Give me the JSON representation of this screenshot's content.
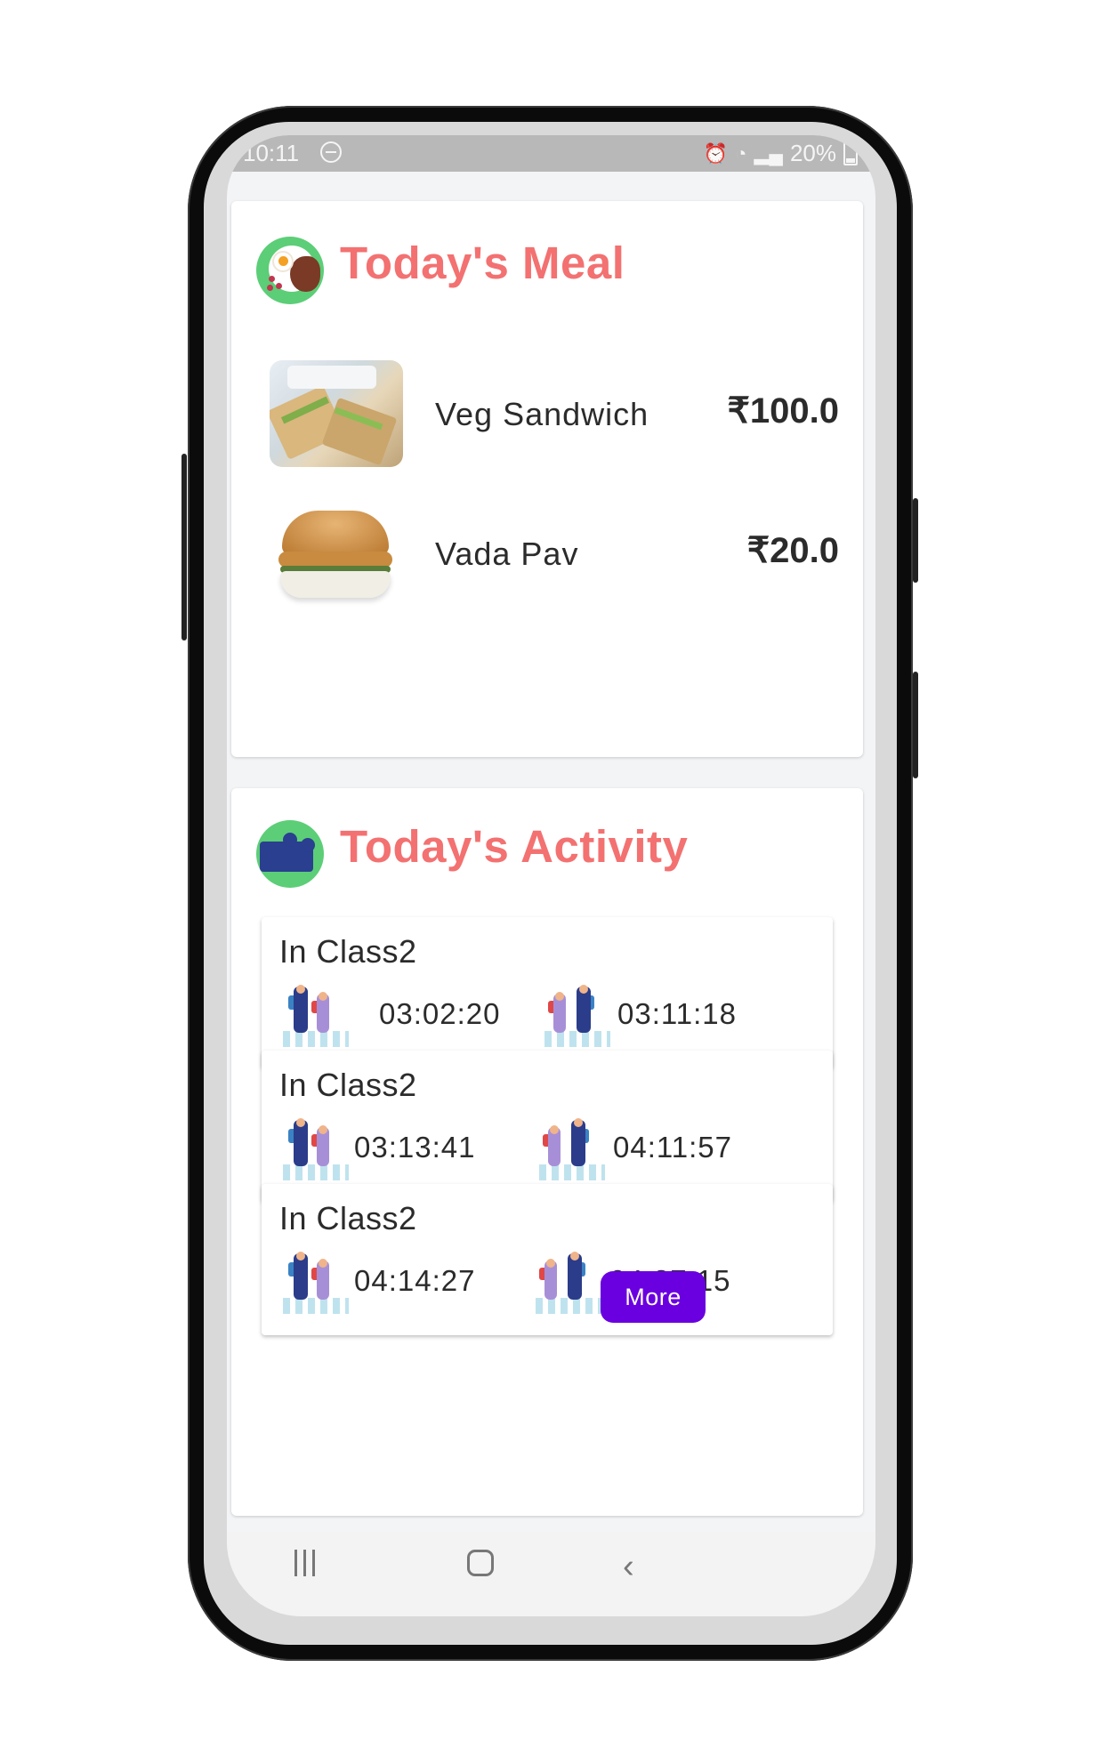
{
  "status_bar": {
    "time": "10:11",
    "battery": "20%"
  },
  "meal": {
    "title": "Today's Meal",
    "items": [
      {
        "name": "Veg Sandwich",
        "price": "₹100.0"
      },
      {
        "name": "Vada Pav",
        "price": "₹20.0"
      }
    ]
  },
  "activity": {
    "title": "Today's Activity",
    "items": [
      {
        "title": "In Class2",
        "in_time": "03:02:20",
        "out_time": "03:11:18"
      },
      {
        "title": "In Class2",
        "in_time": "03:13:41",
        "out_time": "04:11:57"
      },
      {
        "title": "In Class2",
        "in_time": "04:14:27",
        "out_time": "04:27:15"
      }
    ],
    "more_label": "More"
  },
  "colors": {
    "accent": "#f37171",
    "button": "#6a00e0",
    "icon_bg": "#5cce77"
  }
}
